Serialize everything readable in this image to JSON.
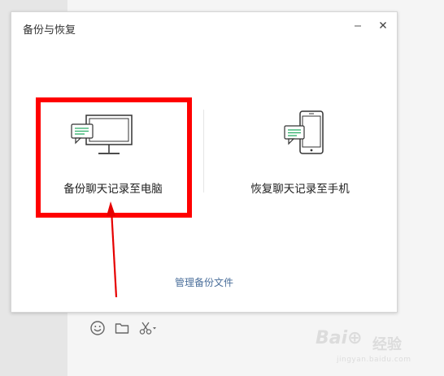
{
  "dialog": {
    "title": "备份与恢复",
    "minimize_icon": "minimize-icon",
    "close_icon": "close-icon",
    "options": [
      {
        "label": "备份聊天记录至电脑",
        "icon": "computer-chat-icon"
      },
      {
        "label": "恢复聊天记录至手机",
        "icon": "phone-chat-icon"
      }
    ],
    "manage_link": "管理备份文件"
  },
  "toolbar": {
    "icons": [
      "emoji-icon",
      "folder-icon",
      "scissors-icon"
    ]
  },
  "watermark": {
    "logo": "Bai⊕",
    "text_cn": "经验",
    "url": "jingyan.baidu.com"
  },
  "colors": {
    "highlight": "#ff0000",
    "icon_green": "#2aae67",
    "link_blue": "#4b6f9b"
  }
}
